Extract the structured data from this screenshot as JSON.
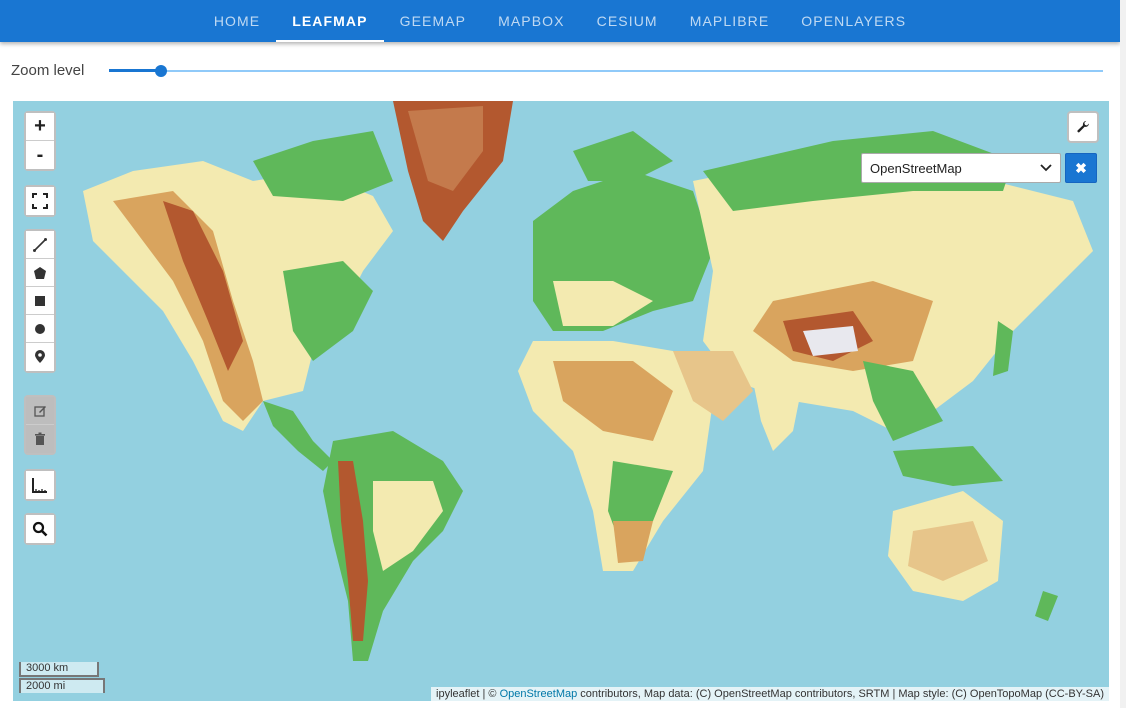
{
  "nav": {
    "tabs": [
      {
        "label": "HOME"
      },
      {
        "label": "LEAFMAP"
      },
      {
        "label": "GEEMAP"
      },
      {
        "label": "MAPBOX"
      },
      {
        "label": "CESIUM"
      },
      {
        "label": "MAPLIBRE"
      },
      {
        "label": "OPENLAYERS"
      }
    ],
    "active": "LEAFMAP"
  },
  "zoom": {
    "label": "Zoom level",
    "value": 0.05
  },
  "map": {
    "zoom_in": "+",
    "zoom_out": "-",
    "basemap_selected": "OpenStreetMap",
    "close_glyph": "✖",
    "scale_km": "3000 km",
    "scale_mi": "2000 mi",
    "attribution_prefix": "ipyleaflet | © ",
    "attribution_link": "OpenStreetMap",
    "attribution_suffix": " contributors, Map data: (C) OpenStreetMap contributors, SRTM | Map style: (C) OpenTopoMap (CC-BY-SA)"
  },
  "colors": {
    "accent": "#1976d2",
    "ocean": "#93d0e0",
    "lowland": "#5fb85a",
    "plain": "#f3eab0",
    "upland": "#d9a45e",
    "mountain": "#b3582f",
    "ice": "#ffffff"
  },
  "icons": [
    "fullscreen-icon",
    "polyline-icon",
    "polygon-icon",
    "rectangle-icon",
    "circle-icon",
    "marker-icon",
    "edit-icon",
    "trash-icon",
    "measure-icon",
    "search-icon",
    "wrench-icon",
    "chevron-down-icon",
    "close-icon"
  ]
}
